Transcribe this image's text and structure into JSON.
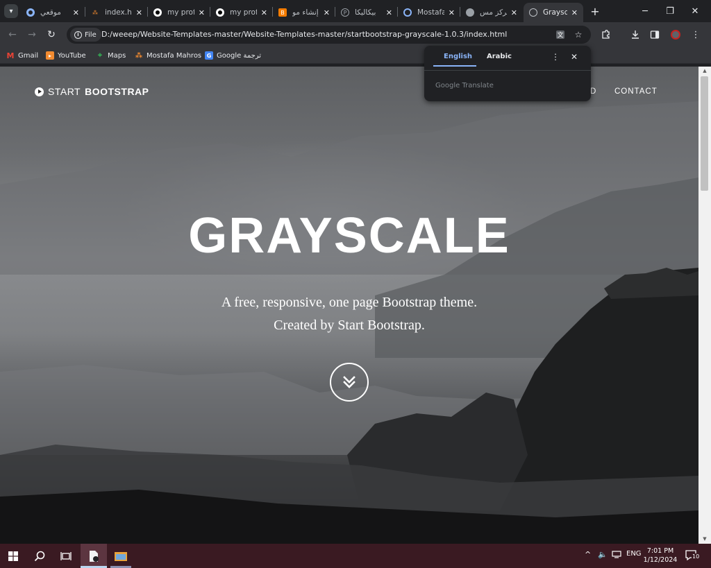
{
  "tabs": [
    {
      "title": "موقعي",
      "favicon": "circle-blue-icon",
      "favcolor": "#8ab4f8"
    },
    {
      "title": "index.ht",
      "favicon": "dots-orange-icon",
      "favcolor": "#f28b30"
    },
    {
      "title": "my prof",
      "favicon": "github-icon",
      "favcolor": "#ffffff"
    },
    {
      "title": "my prof",
      "favicon": "github-icon",
      "favcolor": "#ffffff"
    },
    {
      "title": "إنشاء مو",
      "favicon": "blogger-icon",
      "favcolor": "#f57c00"
    },
    {
      "title": "بيكاليكا",
      "favicon": "p-circle-icon",
      "favcolor": "#9aa0a6"
    },
    {
      "title": "Mostafa",
      "favicon": "target-icon",
      "favcolor": "#8ab4f8"
    },
    {
      "title": "مركز مس",
      "favicon": "globe-icon",
      "favcolor": "#9aa0a6"
    },
    {
      "title": "Graysca",
      "favicon": "globe-icon",
      "favcolor": "#bdc1c6",
      "active": true
    }
  ],
  "toolbar": {
    "chip_label": "File",
    "url": "D:/weeep/Website-Templates-master/Website-Templates-master/startbootstrap-grayscale-1.0.3/index.html"
  },
  "bookmarks": [
    {
      "label": "Gmail",
      "icon": "gmail-icon",
      "color": "#ea4335"
    },
    {
      "label": "YouTube",
      "icon": "youtube-icon",
      "color": "#f28b30"
    },
    {
      "label": "Maps",
      "icon": "maps-icon",
      "color": "#34a853"
    },
    {
      "label": "Mostafa Mahros",
      "icon": "dots-orange-icon",
      "color": "#f28b30"
    },
    {
      "label": "Google ترجمة",
      "icon": "translate-icon",
      "color": "#4285f4"
    }
  ],
  "page": {
    "brand_light": "START",
    "brand_bold": "BOOTSTRAP",
    "nav_partial": "D",
    "nav_contact": "CONTACT",
    "hero_title": "GRAYSCALE",
    "hero_line1": "A free, responsive, one page Bootstrap theme.",
    "hero_line2": "Created by Start Bootstrap."
  },
  "translate_popup": {
    "lang_source": "English",
    "lang_target": "Arabic",
    "footer": "Google Translate",
    "accent": "#8ab4f8"
  },
  "taskbar": {
    "lang": "ENG",
    "time": "7:01 PM",
    "date": "1/12/2024",
    "notifications": "10",
    "background": "#3a1a22"
  }
}
